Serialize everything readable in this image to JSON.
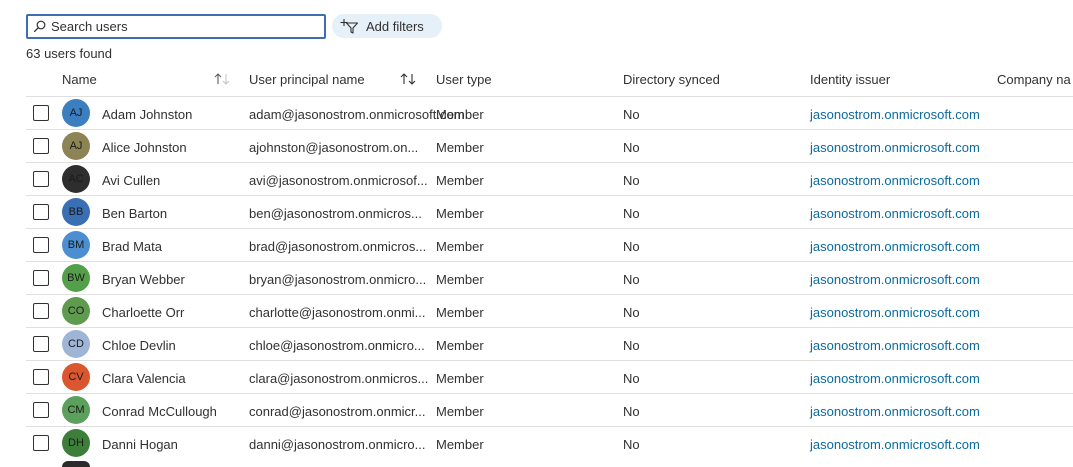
{
  "search": {
    "placeholder": "Search users",
    "value": ""
  },
  "toolbar": {
    "add_filters_label": "Add filters"
  },
  "summary": {
    "count_text": "63 users found"
  },
  "columns": {
    "name": "Name",
    "upn": "User principal name",
    "type": "User type",
    "synced": "Directory synced",
    "issuer": "Identity issuer",
    "company": "Company na"
  },
  "colors": {
    "accent": "#3d6fb0",
    "link": "#0b6a9e",
    "filter_bg": "#e6f0f9"
  },
  "users": [
    {
      "initials": "AJ",
      "name": "Adam Johnston",
      "upn": "adam@jasonostrom.onmicrosoft.com",
      "type": "Member",
      "synced": "No",
      "issuer": "jasonostrom.onmicrosoft.com",
      "avatar_color": "#3c7fc0"
    },
    {
      "initials": "AJ",
      "name": "Alice Johnston",
      "upn": "ajohnston@jasonostrom.on...",
      "type": "Member",
      "synced": "No",
      "issuer": "jasonostrom.onmicrosoft.com",
      "avatar_color": "#8d8456"
    },
    {
      "initials": "AC",
      "name": "Avi Cullen",
      "upn": "avi@jasonostrom.onmicrosof...",
      "type": "Member",
      "synced": "No",
      "issuer": "jasonostrom.onmicrosoft.com",
      "avatar_color": "#2e2e2e"
    },
    {
      "initials": "BB",
      "name": "Ben Barton",
      "upn": "ben@jasonostrom.onmicros...",
      "type": "Member",
      "synced": "No",
      "issuer": "jasonostrom.onmicrosoft.com",
      "avatar_color": "#3a6fb4"
    },
    {
      "initials": "BM",
      "name": "Brad Mata",
      "upn": "brad@jasonostrom.onmicros...",
      "type": "Member",
      "synced": "No",
      "issuer": "jasonostrom.onmicrosoft.com",
      "avatar_color": "#4c8ed0"
    },
    {
      "initials": "BW",
      "name": "Bryan Webber",
      "upn": "bryan@jasonostrom.onmicro...",
      "type": "Member",
      "synced": "No",
      "issuer": "jasonostrom.onmicrosoft.com",
      "avatar_color": "#54a04a"
    },
    {
      "initials": "CO",
      "name": "Charloette Orr",
      "upn": "charlotte@jasonostrom.onmi...",
      "type": "Member",
      "synced": "No",
      "issuer": "jasonostrom.onmicrosoft.com",
      "avatar_color": "#5f9b4e"
    },
    {
      "initials": "CD",
      "name": "Chloe Devlin",
      "upn": "chloe@jasonostrom.onmicro...",
      "type": "Member",
      "synced": "No",
      "issuer": "jasonostrom.onmicrosoft.com",
      "avatar_color": "#9fb5d6"
    },
    {
      "initials": "CV",
      "name": "Clara Valencia",
      "upn": "clara@jasonostrom.onmicros...",
      "type": "Member",
      "synced": "No",
      "issuer": "jasonostrom.onmicrosoft.com",
      "avatar_color": "#d9562f"
    },
    {
      "initials": "CM",
      "name": "Conrad McCullough",
      "upn": "conrad@jasonostrom.onmicr...",
      "type": "Member",
      "synced": "No",
      "issuer": "jasonostrom.onmicrosoft.com",
      "avatar_color": "#5ba05c"
    },
    {
      "initials": "DH",
      "name": "Danni Hogan",
      "upn": "danni@jasonostrom.onmicro...",
      "type": "Member",
      "synced": "No",
      "issuer": "jasonostrom.onmicrosoft.com",
      "avatar_color": "#3d7f3a"
    }
  ]
}
